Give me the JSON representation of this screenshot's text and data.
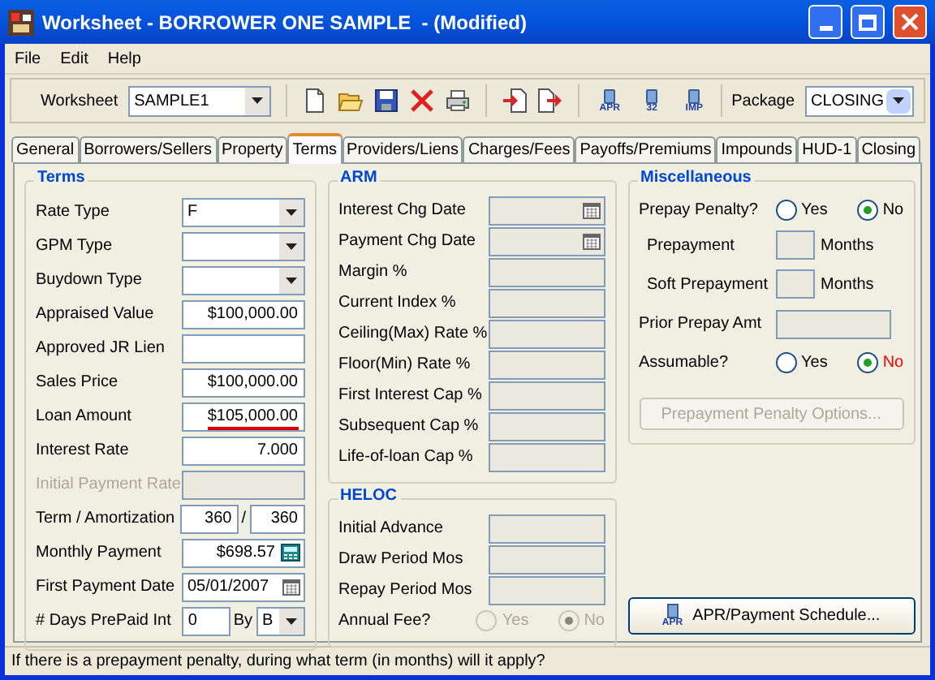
{
  "window": {
    "title": "Worksheet - BORROWER ONE SAMPLE  - (Modified)"
  },
  "menu": [
    "File",
    "Edit",
    "Help"
  ],
  "toolbar": {
    "worksheet_label": "Worksheet",
    "worksheet_value": "SAMPLE1",
    "package_label": "Package",
    "package_value": "CLOSING",
    "tools": [
      {
        "kind": "new"
      },
      {
        "kind": "open"
      },
      {
        "kind": "save"
      },
      {
        "kind": "delete"
      },
      {
        "kind": "print"
      },
      {
        "kind": "separator"
      },
      {
        "kind": "import"
      },
      {
        "kind": "export"
      },
      {
        "kind": "separator"
      },
      {
        "kind": "report",
        "label": "APR"
      },
      {
        "kind": "report",
        "label": "32"
      },
      {
        "kind": "report",
        "label": "IMP"
      }
    ]
  },
  "tabs": [
    {
      "label": "General",
      "selected": false
    },
    {
      "label": "Borrowers/Sellers",
      "selected": false
    },
    {
      "label": "Property",
      "selected": false
    },
    {
      "label": "Terms",
      "selected": true
    },
    {
      "label": "Providers/Liens",
      "selected": false
    },
    {
      "label": "Charges/Fees",
      "selected": false
    },
    {
      "label": "Payoffs/Premiums",
      "selected": false
    },
    {
      "label": "Impounds",
      "selected": false
    },
    {
      "label": "HUD-1",
      "selected": false
    },
    {
      "label": "Closing",
      "selected": false
    }
  ],
  "terms": {
    "title": "Terms",
    "rows": [
      {
        "label": "Rate Type",
        "kind": "select",
        "value": "F",
        "disabled": false,
        "flagged": false
      },
      {
        "label": "GPM Type",
        "kind": "select",
        "disabled": false
      },
      {
        "label": "Buydown Type",
        "kind": "select",
        "disabled": false
      },
      {
        "label": "Appraised Value",
        "kind": "text",
        "value": "$100,000.00",
        "disabled": false,
        "flagged": false
      },
      {
        "label": "Approved JR Lien",
        "kind": "text",
        "disabled": false
      },
      {
        "label": "Sales Price",
        "kind": "text",
        "value": "$100,000.00",
        "disabled": false,
        "flagged": false
      },
      {
        "label": "Loan Amount",
        "kind": "text",
        "value": "$105,000.00",
        "disabled": false,
        "flagged": true
      },
      {
        "label": "Interest Rate",
        "kind": "text",
        "value": "7.000",
        "disabled": false,
        "flagged": false
      },
      {
        "label": "Initial Payment Rate",
        "kind": "text",
        "disabled": true
      },
      {
        "label": "Term / Amortization",
        "kind": "pair",
        "value": "360",
        "separator": "/",
        "value2": "360",
        "disabled": false
      },
      {
        "label": "Monthly Payment",
        "kind": "calc",
        "value": "$698.57",
        "disabled": false,
        "flagged": false
      },
      {
        "label": "First Payment Date",
        "kind": "date",
        "value": "05/01/2007",
        "disabled": false,
        "flagged": false
      },
      {
        "label": "# Days PrePaid Int",
        "kind": "by",
        "value": "0",
        "by_label": "By",
        "by_value": "B",
        "disabled": false
      }
    ]
  },
  "arm": {
    "title": "ARM",
    "rows": [
      {
        "label": "Interest Chg Date",
        "kind": "date",
        "disabled": true
      },
      {
        "label": "Payment Chg Date",
        "kind": "date",
        "disabled": true
      },
      {
        "label": "Margin %",
        "kind": "text",
        "disabled": true
      },
      {
        "label": "Current Index %",
        "kind": "text",
        "disabled": true
      },
      {
        "label": "Ceiling(Max) Rate %",
        "kind": "text",
        "disabled": true
      },
      {
        "label": "Floor(Min) Rate %",
        "kind": "text",
        "disabled": true
      },
      {
        "label": "First Interest Cap %",
        "kind": "text",
        "disabled": true
      },
      {
        "label": "Subsequent Cap %",
        "kind": "text",
        "disabled": true
      },
      {
        "label": "Life-of-loan Cap %",
        "kind": "text",
        "disabled": true
      }
    ]
  },
  "heloc": {
    "title": "HELOC",
    "rows": [
      {
        "label": "Initial Advance",
        "kind": "text",
        "disabled": true
      },
      {
        "label": "Draw Period Mos",
        "kind": "text",
        "disabled": true
      },
      {
        "label": "Repay Period Mos",
        "kind": "text",
        "disabled": true
      }
    ],
    "annual_fee": {
      "label": "Annual Fee?",
      "disabled": true,
      "options": [
        {
          "label": "Yes",
          "selected": false
        },
        {
          "label": "No",
          "selected": true
        }
      ]
    }
  },
  "misc": {
    "title": "Miscellaneous",
    "prepay_penalty": {
      "label": "Prepay Penalty?",
      "disabled": false,
      "options": [
        {
          "label": "Yes",
          "selected": false,
          "flagged": false
        },
        {
          "label": "No",
          "selected": true,
          "flagged": false
        }
      ]
    },
    "prepayment_rows": [
      {
        "label": "Prepayment",
        "unit": "Months"
      },
      {
        "label": "Soft Prepayment",
        "unit": "Months"
      }
    ],
    "prior_prepay": {
      "label": "Prior Prepay Amt"
    },
    "assumable": {
      "label": "Assumable?",
      "disabled": false,
      "options": [
        {
          "label": "Yes",
          "selected": false,
          "flagged": false
        },
        {
          "label": "No",
          "selected": true,
          "flagged": true
        }
      ]
    },
    "options_button": {
      "label": "Prepayment Penalty Options...",
      "disabled": true
    }
  },
  "schedule_button": {
    "label": "APR/Payment Schedule...",
    "icon_label": "APR"
  },
  "status_bar": "If there is a prepayment penalty, during what term (in months) will it apply?"
}
